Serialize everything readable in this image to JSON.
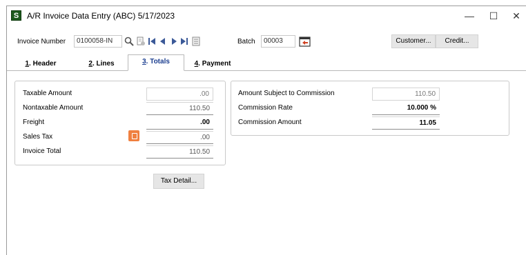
{
  "window": {
    "title": "A/R Invoice Data Entry (ABC) 5/17/2023",
    "app_icon": "S",
    "controls": {
      "minimize": "—",
      "maximize": "☐",
      "close": "✕"
    }
  },
  "toolbar": {
    "invoice_number_label": "Invoice Number",
    "invoice_number_value": "0100058-IN",
    "batch_label": "Batch",
    "batch_value": "00003",
    "customer_button": "Customer...",
    "credit_button": "Credit..."
  },
  "tabs": [
    {
      "num": "1",
      "label": ". Header"
    },
    {
      "num": "2",
      "label": ". Lines"
    },
    {
      "num": "3",
      "label": ". Totals"
    },
    {
      "num": "4",
      "label": ". Payment"
    }
  ],
  "totals": {
    "taxable_amount_label": "Taxable Amount",
    "taxable_amount": ".00",
    "nontaxable_amount_label": "Nontaxable Amount",
    "nontaxable_amount": "110.50",
    "freight_label": "Freight",
    "freight": ".00",
    "sales_tax_label": "Sales Tax",
    "sales_tax": ".00",
    "invoice_total_label": "Invoice Total",
    "invoice_total": "110.50"
  },
  "commission": {
    "subject_label": "Amount Subject to Commission",
    "subject_value": "110.50",
    "rate_label": "Commission Rate",
    "rate_value": "10.000 %",
    "amount_label": "Commission Amount",
    "amount_value": "11.05"
  },
  "tax_detail_button": "Tax Detail...",
  "colors": {
    "active_tab_text": "#1a3d8f",
    "tax_button": "#f08040",
    "app_icon_bg": "#1e5a1e"
  }
}
